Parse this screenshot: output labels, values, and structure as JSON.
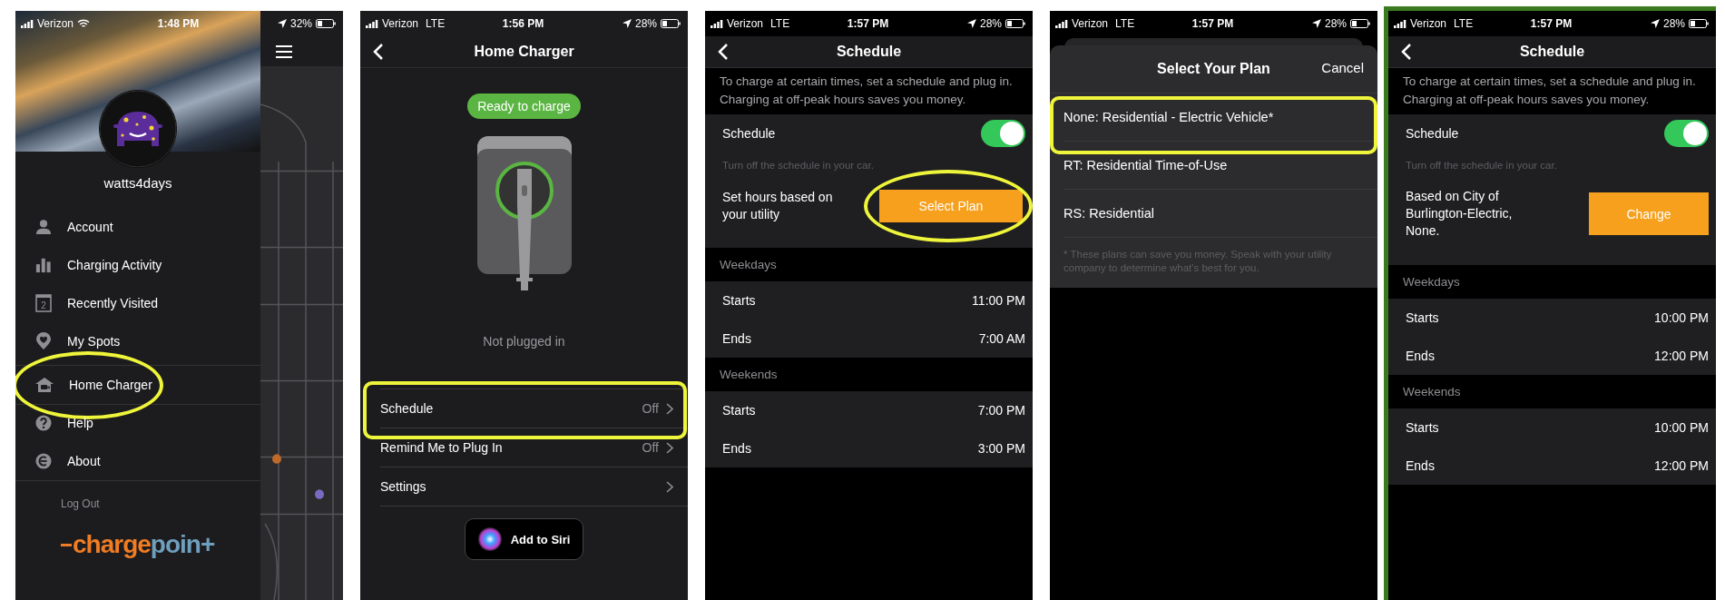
{
  "screens": [
    {
      "kind": "menu",
      "highlighted": false,
      "status_bar": {
        "carrier": "Verizon",
        "wifi": true,
        "time": "1:48 PM",
        "battery": "32%"
      },
      "username": "watts4days",
      "menu": [
        {
          "label": "Account",
          "highlighted": false
        },
        {
          "label": "Charging Activity",
          "highlighted": false
        },
        {
          "label": "Recently Visited",
          "icon_text": "2",
          "highlighted": false
        },
        {
          "label": "My Spots",
          "highlighted": false
        },
        {
          "label": "Home Charger",
          "highlighted": true
        },
        {
          "label": "Help",
          "highlighted": false
        },
        {
          "label": "About",
          "highlighted": false
        }
      ],
      "log_out": "Log Out",
      "logo": {
        "primary": "charge",
        "secondary": "poin+"
      }
    },
    {
      "kind": "charger",
      "highlighted": false,
      "status_bar": {
        "carrier": "Verizon",
        "network": "LTE",
        "time": "1:56 PM",
        "battery": "28%"
      },
      "title": "Home Charger",
      "status_pill": "Ready to charge",
      "plug_status": "Not plugged in",
      "rows": [
        {
          "label": "Schedule",
          "value": "Off",
          "highlighted": true
        },
        {
          "label": "Remind Me to Plug In",
          "value": "Off",
          "highlighted": false
        },
        {
          "label": "Settings",
          "highlighted": false
        }
      ],
      "siri_button": "Add to Siri"
    },
    {
      "kind": "schedule",
      "highlighted": false,
      "status_bar": {
        "carrier": "Verizon",
        "network": "LTE",
        "time": "1:57 PM",
        "battery": "28%"
      },
      "title": "Schedule",
      "intro": "To charge at certain times, set a schedule and plug in. Charging at off-peak hours saves you money.",
      "schedule_label": "Schedule",
      "schedule_on": true,
      "hint": "Turn off the schedule in your car.",
      "plan_text": "Set hours based on your utility",
      "plan_button": {
        "label": "Select Plan",
        "highlighted": true
      },
      "groups": [
        {
          "heading": "Weekdays",
          "rows": [
            {
              "label": "Starts",
              "value": "11:00 PM"
            },
            {
              "label": "Ends",
              "value": "7:00 AM"
            }
          ]
        },
        {
          "heading": "Weekends",
          "rows": [
            {
              "label": "Starts",
              "value": "7:00 PM"
            },
            {
              "label": "Ends",
              "value": "3:00 PM"
            }
          ]
        }
      ]
    },
    {
      "kind": "plan_picker",
      "highlighted": false,
      "status_bar": {
        "carrier": "Verizon",
        "network": "LTE",
        "time": "1:57 PM",
        "battery": "28%"
      },
      "title": "Select Your Plan",
      "cancel": "Cancel",
      "plans": [
        {
          "label": "None: Residential - Electric Vehicle*",
          "highlighted": true
        },
        {
          "label": "RT: Residential Time-of-Use",
          "highlighted": false
        },
        {
          "label": "RS: Residential",
          "highlighted": false
        }
      ],
      "footnote": "* These plans can save you money. Speak with your utility company to determine what's best for you."
    },
    {
      "kind": "schedule",
      "highlighted": true,
      "status_bar": {
        "carrier": "Verizon",
        "network": "LTE",
        "time": "1:57 PM",
        "battery": "28%"
      },
      "title": "Schedule",
      "intro": "To charge at certain times, set a schedule and plug in. Charging at off-peak hours saves you money.",
      "schedule_label": "Schedule",
      "schedule_on": true,
      "hint": "Turn off the schedule in your car.",
      "plan_text": "Based on City of Burlington-Electric, None.",
      "plan_button": {
        "label": "Change",
        "highlighted": false
      },
      "groups": [
        {
          "heading": "Weekdays",
          "rows": [
            {
              "label": "Starts",
              "value": "10:00 PM"
            },
            {
              "label": "Ends",
              "value": "12:00 PM"
            }
          ]
        },
        {
          "heading": "Weekends",
          "rows": [
            {
              "label": "Starts",
              "value": "10:00 PM"
            },
            {
              "label": "Ends",
              "value": "12:00 PM"
            }
          ]
        }
      ]
    }
  ]
}
